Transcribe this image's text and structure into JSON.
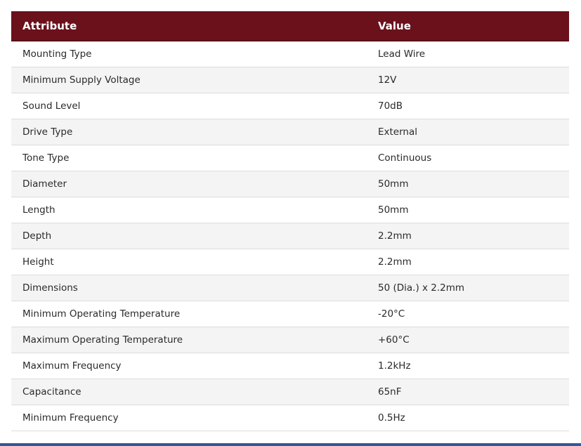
{
  "table": {
    "headers": [
      "Attribute",
      "Value"
    ],
    "rows": [
      [
        "Mounting Type",
        "Lead Wire"
      ],
      [
        "Minimum Supply Voltage",
        "12V"
      ],
      [
        "Sound Level",
        "70dB"
      ],
      [
        "Drive Type",
        "External"
      ],
      [
        "Tone Type",
        "Continuous"
      ],
      [
        "Diameter",
        "50mm"
      ],
      [
        "Length",
        "50mm"
      ],
      [
        "Depth",
        "2.2mm"
      ],
      [
        "Height",
        "2.2mm"
      ],
      [
        "Dimensions",
        "50 (Dia.) x 2.2mm"
      ],
      [
        "Minimum Operating Temperature",
        "-20°C"
      ],
      [
        "Maximum Operating Temperature",
        "+60°C"
      ],
      [
        "Maximum Frequency",
        "1.2kHz"
      ],
      [
        "Capacitance",
        "65nF"
      ],
      [
        "Minimum Frequency",
        "0.5Hz"
      ]
    ]
  },
  "colors": {
    "header_bg": "#6b111c",
    "header_text": "#ffffff",
    "row_alt_bg": "#f4f4f4",
    "bottom_bar": "#2e5a9c"
  }
}
